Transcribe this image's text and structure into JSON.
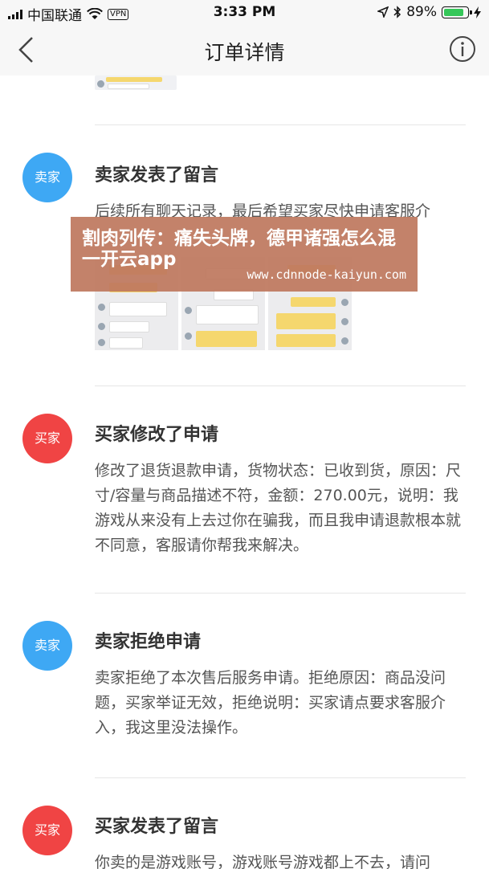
{
  "status_bar": {
    "carrier": "中国联通",
    "vpn": "VPN",
    "time": "3:33 PM",
    "battery": "89%",
    "battery_level": 0.89,
    "battery_color": "#35c759"
  },
  "nav": {
    "title": "订单详情",
    "back_icon": "chevron-left-icon",
    "info_icon": "info-circle-icon"
  },
  "entries": [
    {
      "avatar": "卖家",
      "avatar_color": "#3ea8f4",
      "title": "卖家发表了留言",
      "body": "后续所有聊天记录，最后希望买家尽快申请客服介"
    },
    {
      "avatar": "买家",
      "avatar_color": "#f04444",
      "title": "买家修改了申请",
      "body": "修改了退货退款申请，货物状态：已收到货，原因：尺寸/容量与商品描述不符，金额：270.00元，说明：我游戏从来没有上去过你在骗我，而且我申请退款根本就不同意，客服请你帮我来解决。"
    },
    {
      "avatar": "卖家",
      "avatar_color": "#3ea8f4",
      "title": "卖家拒绝申请",
      "body": "卖家拒绝了本次售后服务申请。拒绝原因：商品没问题，买家举证无效，拒绝说明：买家请点要求客服介入，我这里没法操作。"
    },
    {
      "avatar": "买家",
      "avatar_color": "#f04444",
      "title": "买家发表了留言",
      "body": "你卖的是游戏账号，游戏账号游戏都上不去，请问"
    }
  ],
  "banner": {
    "title": "割肉列传：痛失头牌，德甲诸强怎么混一开云app",
    "url": "www.cdnnode-kaiyun.com"
  }
}
